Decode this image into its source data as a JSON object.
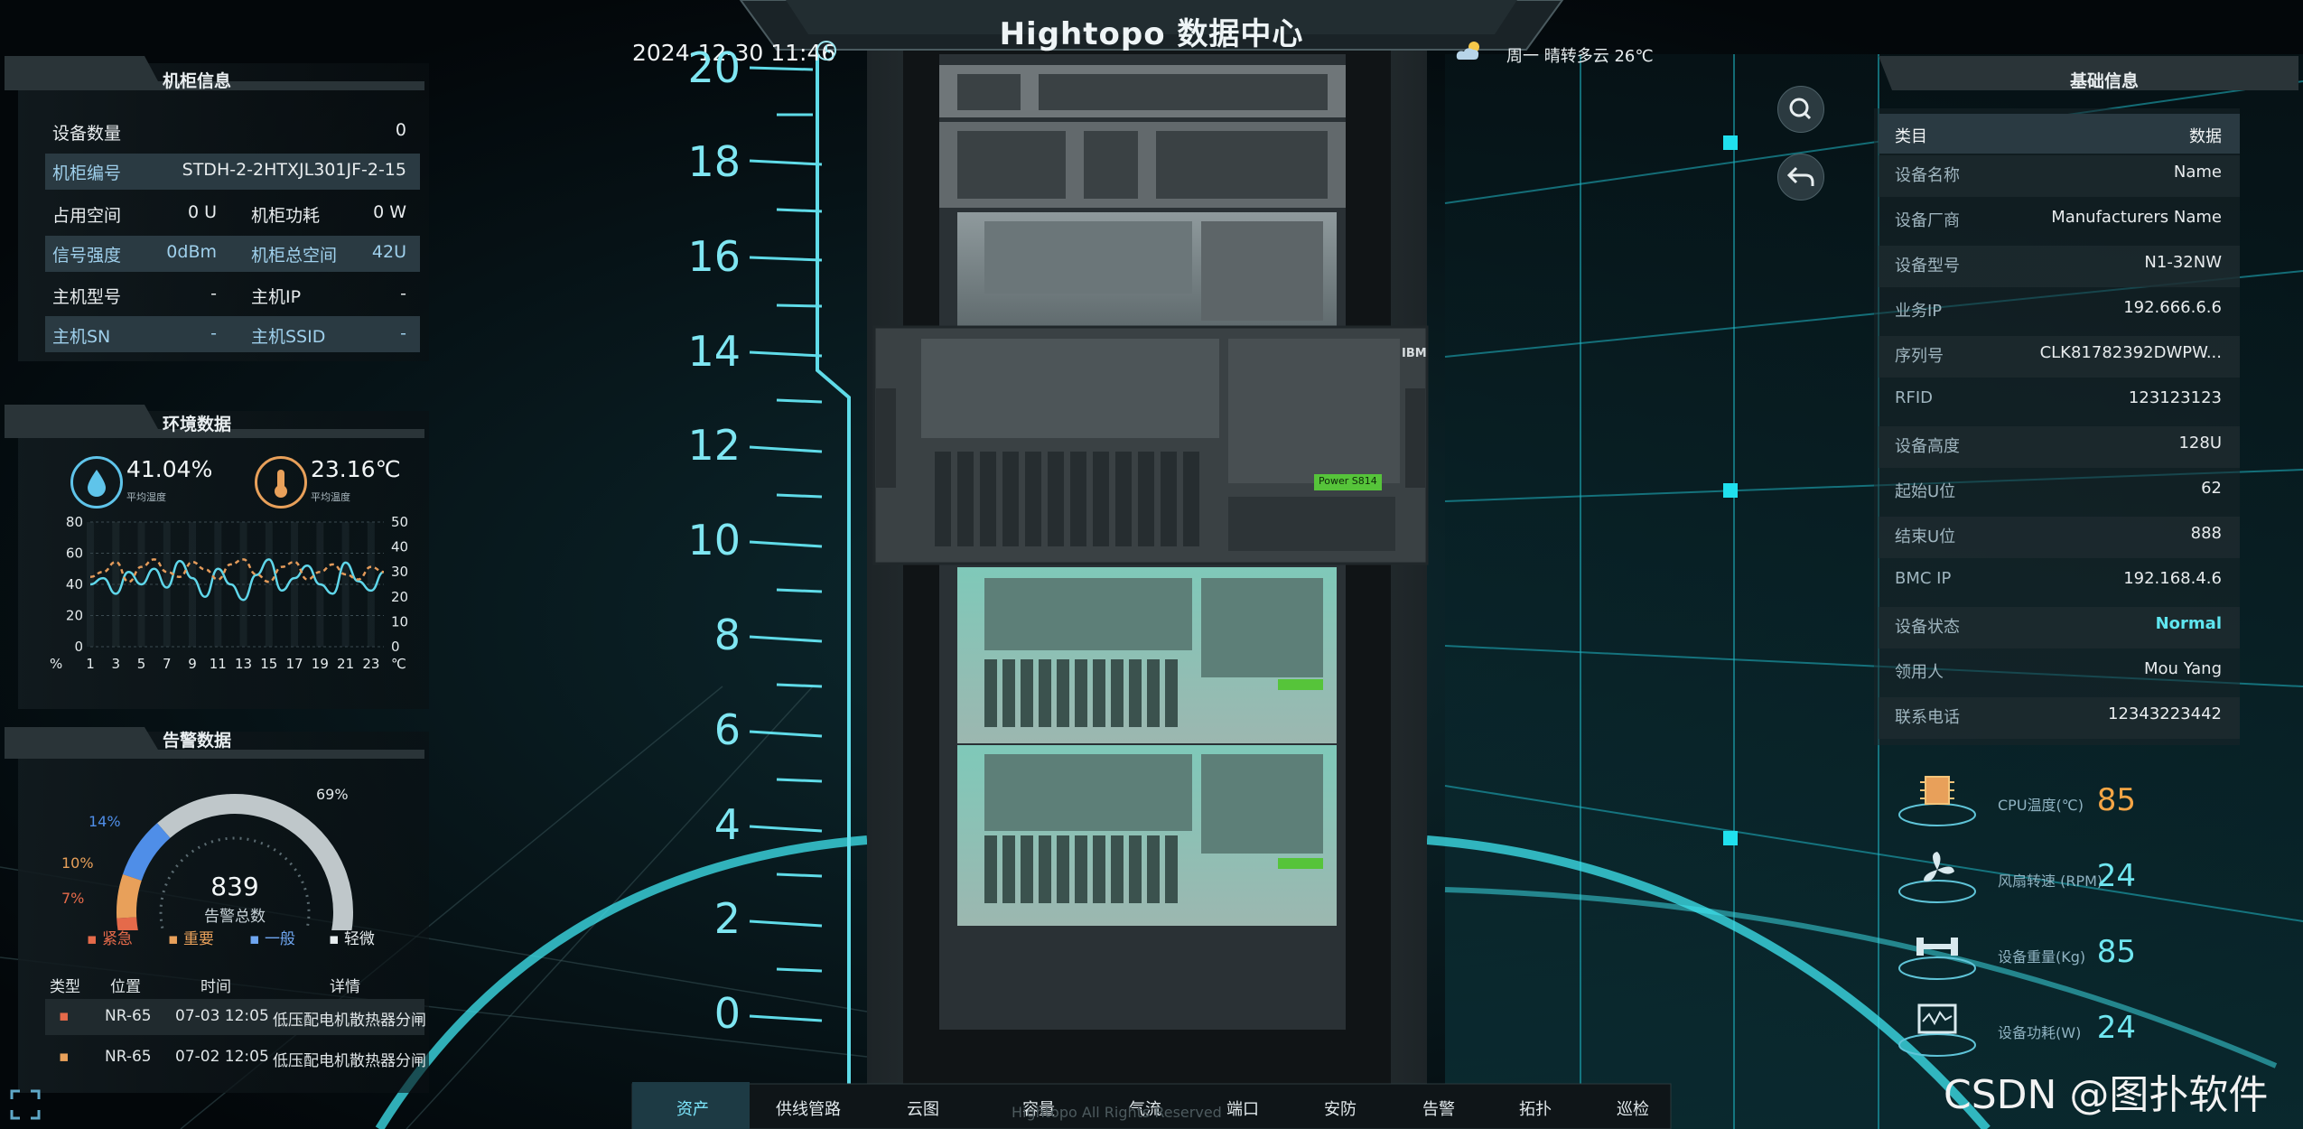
{
  "header": {
    "title": "Hightopo 数据中心",
    "datetime": "2024-12-30 11:46",
    "weather": "周一   晴转多云 26℃"
  },
  "cabinet_info": {
    "title": "机柜信息",
    "device_count_label": "设备数量",
    "device_count_value": "0",
    "cabinet_id_label": "机柜编号",
    "cabinet_id_value": "STDH-2-2HTXJL301JF-2-15",
    "used_space_label": "占用空间",
    "used_space_value": "0 U",
    "cabinet_power_label": "机柜功耗",
    "cabinet_power_value": "0 W",
    "signal_label": "信号强度",
    "signal_value": "0dBm",
    "total_space_label": "机柜总空间",
    "total_space_value": "42U",
    "host_model_label": "主机型号",
    "host_model_value": "-",
    "host_ip_label": "主机IP",
    "host_ip_value": "-",
    "host_sn_label": "主机SN",
    "host_sn_value": "-",
    "host_ssid_label": "主机SSID",
    "host_ssid_value": "-"
  },
  "environment": {
    "title": "环境数据",
    "humidity_value": "41.04%",
    "humidity_label": "平均湿度",
    "temperature_value": "23.16℃",
    "temperature_label": "平均温度",
    "left_axis_unit": "%",
    "right_axis_unit": "℃"
  },
  "alarm": {
    "title": "告警数据",
    "total": "839",
    "total_label": "告警总数",
    "pct_top": "69%",
    "pct_a": "14%",
    "pct_b": "10%",
    "pct_c": "7%",
    "legend": [
      "紧急",
      "重要",
      "一般",
      "轻微"
    ],
    "columns": [
      "类型",
      "位置",
      "时间",
      "详情"
    ],
    "rows": [
      {
        "pos": "NR-65",
        "time": "07-03 12:05",
        "detail": "低压配电机散热器分闸"
      },
      {
        "pos": "NR-65",
        "time": "07-02 12:05",
        "detail": "低压配电机散热器分闸"
      }
    ]
  },
  "ruler": {
    "marks": [
      "20",
      "18",
      "16",
      "14",
      "12",
      "10",
      "8",
      "6",
      "4",
      "2",
      "0"
    ]
  },
  "basic_info": {
    "title": "基础信息",
    "col_category": "类目",
    "col_data": "数据",
    "rows": [
      {
        "label": "设备名称",
        "value": "Name"
      },
      {
        "label": "设备厂商",
        "value": "Manufacturers Name"
      },
      {
        "label": "设备型号",
        "value": "N1-32NW"
      },
      {
        "label": "业务IP",
        "value": "192.666.6.6"
      },
      {
        "label": "序列号",
        "value": "CLK81782392DWPW..."
      },
      {
        "label": "RFID",
        "value": "123123123"
      },
      {
        "label": "设备高度",
        "value": "128U"
      },
      {
        "label": "起始U位",
        "value": "62"
      },
      {
        "label": "结束U位",
        "value": "888"
      },
      {
        "label": "BMC IP",
        "value": "192.168.4.6"
      },
      {
        "label": "设备状态",
        "value": "Normal"
      },
      {
        "label": "领用人",
        "value": "Mou Yang"
      },
      {
        "label": "联系电话",
        "value": "12343223442"
      }
    ]
  },
  "metrics": [
    {
      "label": "CPU温度(℃)",
      "value": "85",
      "color": "#f5a545"
    },
    {
      "label": "风扇转速 (RPM)",
      "value": "24",
      "color": "#6fe6f0"
    },
    {
      "label": "设备重量(Kg)",
      "value": "85",
      "color": "#6fe6f0"
    },
    {
      "label": "设备功耗(W)",
      "value": "24",
      "color": "#6fe6f0"
    }
  ],
  "server": {
    "power_label": "Power S814",
    "brand": "IBM"
  },
  "nav": [
    "资产",
    "供线管路",
    "云图",
    "容量",
    "气流",
    "端口",
    "安防",
    "告警",
    "拓扑",
    "巡检"
  ],
  "footer_watermark": "Hightopo All Rights Reserved",
  "csdn": "CSDN @图扑软件",
  "chart_data": {
    "type": "line",
    "x": [
      1,
      2,
      3,
      4,
      5,
      6,
      7,
      8,
      9,
      10,
      11,
      12,
      13,
      14,
      15,
      16,
      17,
      18,
      19,
      20,
      21,
      22,
      23,
      24
    ],
    "xticks": [
      "1",
      "3",
      "5",
      "7",
      "9",
      "11",
      "13",
      "15",
      "17",
      "19",
      "21",
      "23"
    ],
    "ylim_left": [
      0,
      80
    ],
    "yticks_left": [
      "0",
      "20",
      "40",
      "60",
      "80"
    ],
    "ylim_right": [
      0,
      50
    ],
    "yticks_right": [
      "0",
      "10",
      "20",
      "30",
      "40",
      "50"
    ],
    "series": [
      {
        "axis": "left",
        "color": "#5fd6ea",
        "values": [
          40,
          44,
          34,
          48,
          40,
          50,
          38,
          55,
          44,
          32,
          50,
          40,
          30,
          46,
          56,
          36,
          44,
          52,
          40,
          34,
          54,
          42,
          36,
          48
        ]
      },
      {
        "axis": "right",
        "color": "#e39a5a",
        "values": [
          28,
          30,
          34,
          26,
          32,
          35,
          30,
          28,
          34,
          31,
          27,
          33,
          35,
          29,
          26,
          32,
          34,
          27,
          30,
          33,
          29,
          27,
          32,
          30
        ]
      }
    ]
  },
  "gauge_data": {
    "segments": [
      0.69,
      0.14,
      0.1,
      0.07
    ]
  }
}
